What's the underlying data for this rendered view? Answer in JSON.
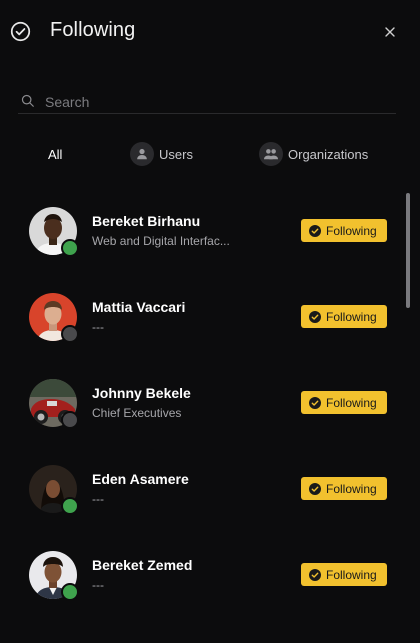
{
  "header": {
    "title": "Following",
    "icon": "check-circle-icon",
    "close_icon": "close-icon"
  },
  "search": {
    "placeholder": "Search",
    "value": ""
  },
  "tabs": [
    {
      "label": "All",
      "active": true
    },
    {
      "label": "Users",
      "icon": "user-icon"
    },
    {
      "label": "Organizations",
      "icon": "group-icon"
    }
  ],
  "users": [
    {
      "name": "Bereket Birhanu",
      "subtitle": "Web and Digital Interfac...",
      "status": "online",
      "button": "Following"
    },
    {
      "name": "Mattia Vaccari",
      "subtitle": "---",
      "status": "offline",
      "button": "Following"
    },
    {
      "name": "Johnny Bekele",
      "subtitle": "Chief Executives",
      "status": "offline",
      "button": "Following"
    },
    {
      "name": "Eden Asamere",
      "subtitle": "---",
      "status": "online",
      "button": "Following"
    },
    {
      "name": "Bereket Zemed",
      "subtitle": "---",
      "status": "online",
      "button": "Following"
    }
  ],
  "colors": {
    "accent": "#f2c12e",
    "background": "#0c0c0d",
    "online": "#3fa34d",
    "offline": "#4a4a4c"
  }
}
